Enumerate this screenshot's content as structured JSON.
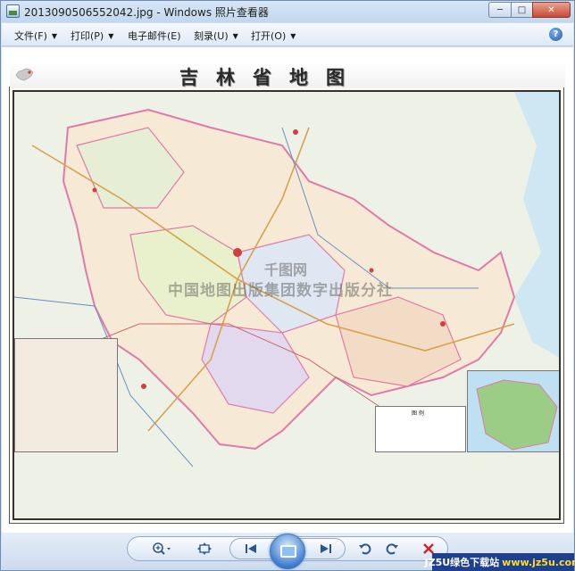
{
  "window": {
    "title": "2013090506552042.jpg - Windows 照片查看器",
    "minimize_label": "─",
    "maximize_label": "□",
    "close_label": "✕"
  },
  "menu": {
    "items": [
      {
        "label": "文件(F)",
        "has_dropdown": true
      },
      {
        "label": "打印(P)",
        "has_dropdown": true
      },
      {
        "label": "电子邮件(E)",
        "has_dropdown": false
      },
      {
        "label": "刻录(U)",
        "has_dropdown": true
      },
      {
        "label": "打开(O)",
        "has_dropdown": true
      }
    ],
    "dropdown_arrow": "▼",
    "help_label": "?"
  },
  "map": {
    "title": "吉林省地图",
    "watermark_line1": "千图网",
    "watermark_line2": "中国地图出版集团数字出版分社",
    "legend_title": "图 例"
  },
  "toolbar": {
    "zoom_icon": "zoom-icon",
    "fit_icon": "actual-size-icon",
    "prev_icon": "previous-icon",
    "slideshow_icon": "slideshow-icon",
    "next_icon": "next-icon",
    "rotate_ccw_icon": "rotate-counterclockwise-icon",
    "rotate_cw_icon": "rotate-clockwise-icon",
    "delete_icon": "delete-icon"
  },
  "badge": {
    "brand": "JZ5U绿色下载站",
    "url": "www.jz5u.com"
  },
  "colors": {
    "accent": "#2c5590",
    "delete": "#d42020",
    "badge_bg": "#1f3f8f"
  }
}
